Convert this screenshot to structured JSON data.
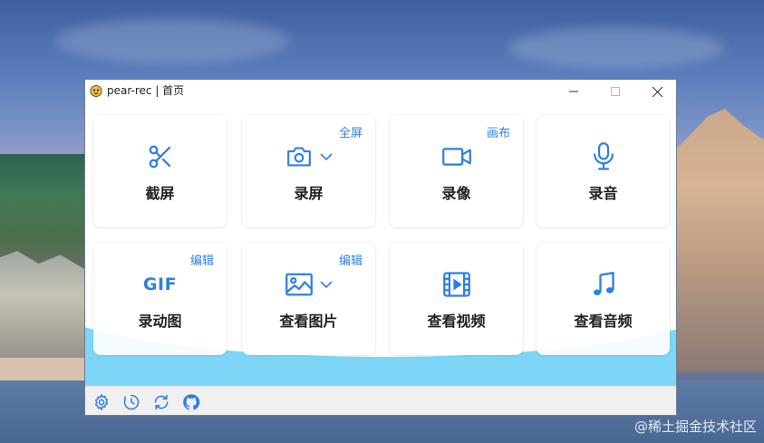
{
  "window": {
    "title": "pear-rec | 首页"
  },
  "cards": [
    {
      "label": "截屏",
      "tag": "",
      "icon": "scissors-icon"
    },
    {
      "label": "录屏",
      "tag": "全屏",
      "icon": "camera-icon"
    },
    {
      "label": "录像",
      "tag": "画布",
      "icon": "video-camera-icon"
    },
    {
      "label": "录音",
      "tag": "",
      "icon": "microphone-icon"
    },
    {
      "label": "录动图",
      "tag": "编辑",
      "icon": "gif-icon",
      "icon_text": "GIF"
    },
    {
      "label": "查看图片",
      "tag": "编辑",
      "icon": "image-icon"
    },
    {
      "label": "查看视频",
      "tag": "",
      "icon": "film-icon"
    },
    {
      "label": "查看音频",
      "tag": "",
      "icon": "music-note-icon"
    }
  ],
  "footer": {
    "icons": [
      "settings-icon",
      "history-icon",
      "refresh-icon",
      "github-icon"
    ]
  },
  "watermark": "@稀土掘金技术社区",
  "colors": {
    "accent": "#2f7fe0",
    "wave": "#7dd6f7",
    "footer_bg": "#f0f0f0"
  }
}
